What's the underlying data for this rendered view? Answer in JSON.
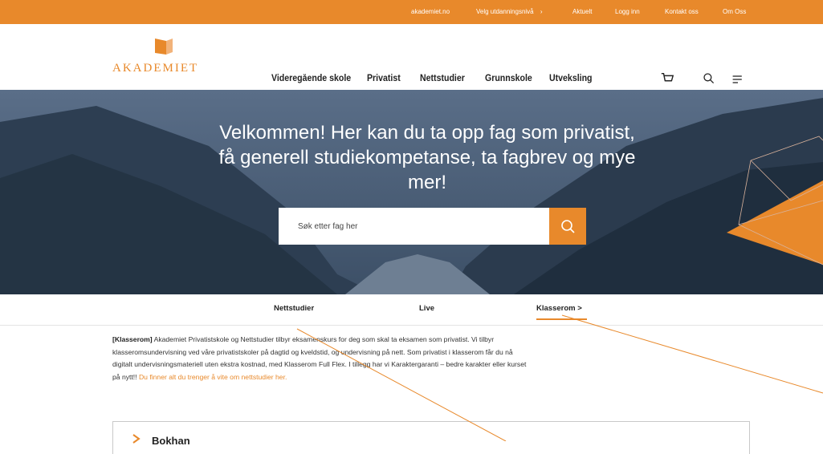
{
  "topbar": {
    "site": "akademiet.no",
    "level_select": "Velg utdanningsnivå",
    "level_select_arrow": "›",
    "news": "Aktuelt",
    "login": "Logg inn",
    "contact": "Kontakt oss",
    "about": "Om Oss"
  },
  "logo": {
    "text": "AKADEMIET"
  },
  "nav": {
    "items": [
      "Videregående skole",
      "Privatist",
      "Nettstudier",
      "Grunnskole",
      "Utveksling"
    ]
  },
  "header_icons": [
    "cart-icon",
    "search-icon",
    "menu-icon"
  ],
  "hero": {
    "title": "Velkommen! Her kan du ta opp fag som privatist, få generell studiekompetanse, ta fagbrev og mye mer!",
    "search_placeholder": "Søk etter fag her"
  },
  "subtabs": {
    "items": [
      "Nettstudier",
      "Live",
      "Klasserom >"
    ],
    "active": "Klasserom >"
  },
  "content": {
    "lead_tag": "[Klasserom]",
    "body": " Akademiet Privatistskole og Nettstudier tilbyr eksamenskurs for deg som skal ta eksamen som privatist. Vi tilbyr klasseromsundervisning ved våre privatistskoler på dagtid og kveldstid, og undervisning på nett. Som privatist i klasserom får du nå digitalt undervisningsmateriell uten ekstra kostnad, med Klasserom Full Flex. I tillegg har vi Karaktergaranti – bedre karakter eller kurset på nytt!!",
    "link_text": " Du finner alt du trenger å vite om nettstudier her."
  },
  "accordion": {
    "title": "Bokhan"
  },
  "colors": {
    "accent": "#e8892b",
    "hero_base": "#3d5068",
    "text": "#222222"
  }
}
